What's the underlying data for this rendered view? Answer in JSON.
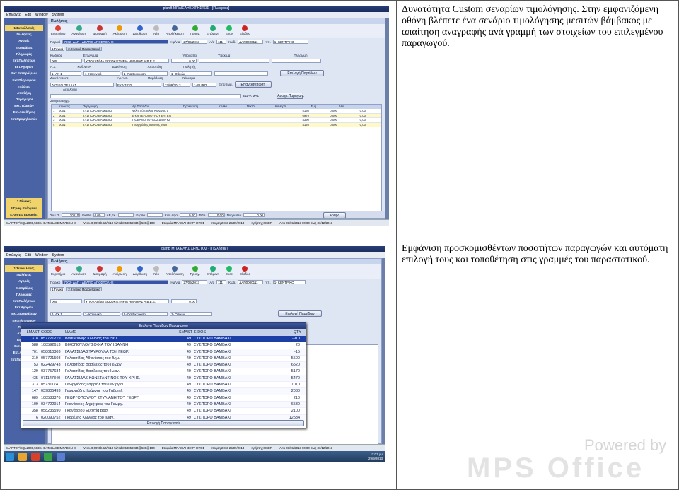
{
  "captions": {
    "row1": "Δυνατότητα Custom σεναρίων τιμολόγησης. Στην εμφανιζόμενη οθόνη βλέπετε ένα σενάριο τιμολόγησης μεσιτών βάμβακος με απαίτηση αναγραφής ανά γραμμή των στοιχείων του επιλεγμένου παραγωγού.",
    "row2": "Εμφάνιση προσκομισθέντων ποσοτήτων παραγωγών και αυτόματη επιλογή τους και τοποθέτηση στις γραμμές του παραστατικού."
  },
  "app": {
    "window_title": "planB ΜΠΑΙΕΛΗΣ ΧΡΗΣΤΟΣ - [Πωλήσεις]",
    "menu": [
      "Επιλογές",
      "Edit",
      "Window",
      "System"
    ],
    "sidebar_header": "1.Συναλλαγές",
    "sidebar_items": [
      "Πωλήσεις",
      "Αγορές",
      "Εισπράξεις",
      "Πληρωμές",
      "Εκτ.Πωλήσεων",
      "Εκτ.Αγορών",
      "Εκτ.Εισπράξεων",
      "Εκτ.Πληρωμών",
      "Πελάτες",
      "Αποθήκη",
      "Παραγωγοί",
      "Εκτ.Πελατών",
      "Εκτ.Αποθήκης",
      "Εκτ.Προμηθευτών"
    ],
    "sidebar_bottom": [
      "2.Πίνακες",
      "3.Γραφ.Ενέργειας",
      "4.Λοιπές Εργασίες"
    ],
    "content_title": "Πωλήσεις",
    "toolbar": [
      "Ευρετήριο",
      "Ανανέωση",
      "Διαγραφή",
      "Ακύρωση",
      "Διόρθωση",
      "Νέο",
      "Αποθήκευση",
      "Προηγ.",
      "Επόμενη",
      "Excel",
      "Εξοδος"
    ],
    "header": {
      "doc_type_label": "Παρ/κό",
      "doc_type_value": "7002- ΔΑΠ - ΔΕΛΤΙΟ ΑΠΟΣΤΟΛΗΣ",
      "date_label": "Ημ/νία",
      "date_value": "27/09/2013",
      "number_label": "Α/α",
      "number_value": "111",
      "code_label": "Κωδ.",
      "code_value": "ΔΑΠ0000111",
      "store_label": "Υπ.",
      "store_value": "1- ΚΕΝΤΡΙΚΟ"
    },
    "tabs": [
      "1.Γενικά",
      "2.Σχετικά Παραστατικά"
    ],
    "customer": {
      "code_label": "Κωδικός",
      "code_value": "005",
      "name_label": "Επωνυμία",
      "name_value": "ΥΠΟΚΑΤ/ΜΑ ΕΚΚΟΚΙΣΤΗΡΙΑ ΗΜΑΘΙΑΣ Α.Β.Ε.Ε.",
      "balance_label": "Υπόλοιπο",
      "balance_value": "0,00",
      "branch_label": "Υποκ/μα",
      "payment_label": "Πληρωμή",
      "am_label": "Α.Χ.",
      "am_value": "1- ΑΧ 1",
      "vat_label": "Καθ.ΦΠΑ",
      "vat_value": "1- Κανονικό",
      "route_label": "Διακίνηση",
      "route_value": "1- Για Εκκόκιση",
      "send_label": "Αποστολή",
      "send_value": "1- Οδικώς",
      "seller_label": "Πωλητής",
      "producers_button": "Επιλογή Παρτίδων",
      "addr_label": "Διευθ.Αποστ.",
      "addr_value": "ΔΥΤΙΚΟ ΠΕΛΛΑΣ",
      "car_label": "Αρ.Αυτ.",
      "car_value": "ΕΚΑ 7420",
      "deliv_label": "Παράδοση",
      "deliv_value": "27/09/2013",
      "currency_label": "Νόμισμα",
      "currency_value": "1- EURO",
      "print_label": "Εκτυπωμ.",
      "reprint_button": "Επανεκτύπωση",
      "reason_label": "Αιτιολογία",
      "edra_label": "ΕΔΡΑ ΜΑΣ",
      "price_button": "Αναγρ.Παραγωγ."
    },
    "lines_header": "Στοιχεία Εγγρ.",
    "grid_columns": [
      "Κωδικός",
      "Περιγραφή",
      "Αρ.Παρτίδος",
      "Προέλευση",
      "Κόλλα",
      "Μικτά",
      "Καθαρά",
      "Τιμή",
      "Αξία"
    ],
    "grid_rows": [
      [
        "0001",
        "ΣΥΣΠΟΡΟ ΒΑΜΒΑΚΙ",
        "Φιλιππόπουλος Κων/νος τ",
        "",
        "",
        "",
        "5130",
        "0,000",
        "0,00"
      ],
      [
        "0001",
        "ΣΥΣΠΟΡΟ ΒΑΜΒΑΚΙ",
        "ΕΥΑΓΓΕΛΟΠΟΥΛΟΥ ΕΥΓΕΝ",
        "",
        "",
        "",
        "6970",
        "0,000",
        "0,00"
      ],
      [
        "0001",
        "ΣΥΣΠΟΡΟ ΒΑΜΒΑΚΙ",
        "ΓΙΟΒΑΝΟΠΟΥΛΟΣ ΔΙΟΝΥΣ",
        "",
        "",
        "",
        "4390",
        "0,000",
        "0,00"
      ],
      [
        "0001",
        "ΣΥΣΠΟΡΟ ΒΑΜΒΑΚΙ",
        "Γεωργιάδης Ιωάννης του Γ",
        "",
        "",
        "",
        "4120",
        "0,000",
        "0,00"
      ]
    ],
    "totals": {
      "qty_label": "Συν.Π.",
      "qty_value": "20610",
      "exp_label": "Εκπ%",
      "exp_value": "0,00",
      "ae_label": "ΑΕ,Εκ.",
      "exod_label": "Εξοδα",
      "kath_label": "Καθ.Αξία",
      "kath_value": "0,00",
      "fpa_label": "ΦΠΑ",
      "fpa_value": "0,00",
      "pay_label": "Πληρωτέο",
      "pay_value": "0,00",
      "print_button": "Αρθρο"
    },
    "status": [
      "SLAPTOP\\SQL2008,50304 DATABASE:MPABELHS",
      "Vers. 0,9998b 10/9/13 5i/%dc058859034@500@100",
      "Εταιρεία:ΜΠΑΙΕΛΗΣ ΧΡΗΣΤΟΣ",
      "Χρήση:2013 29/09/2013",
      "Χρήστης:USER",
      "Απο 01/01/2013 00:00 Εως 31/12/2013"
    ]
  },
  "popup": {
    "title": "Επιλογή Παρτίδων Παραγωγού",
    "columns": [
      "LMAST",
      "CODE",
      "NAME",
      "SMAST",
      "EIDOS",
      "QTY"
    ],
    "rows": [
      [
        "318",
        "057721219",
        "Βασιλειάδης Κων/νος του Θεμ.",
        "49",
        "ΣΥΣΠΟΡΟ ΒΑΜΒΑΚΙ",
        "-910"
      ],
      [
        "588",
        "108592613",
        "ΒΙΚΟΠΟΥΛΟΥ ΣΟΦΙΑ ΤΟΥ ΙΩΑΝΝΗ",
        "49",
        "ΣΥΣΠΟΡΟ ΒΑΜΒΑΚΙ",
        "20"
      ],
      [
        "701",
        "058010303",
        "ΓΑΛΑΤΣΙΔΑ ΣΤΑΥΡΟΥΛΑ ΤΟΥ ΓΕΩΡ.",
        "49",
        "ΣΥΣΠΟΡΟ ΒΑΜΒΑΚΙ",
        "-15"
      ],
      [
        "319",
        "057721508",
        "Γαλατσίδας Αθανάσιος του Δημ.",
        "49",
        "ΣΥΣΠΟΡΟ ΒΑΜΒΑΚΙ",
        "5500"
      ],
      [
        "53",
        "022429743",
        "Γαλατσίδας Βασίλειος του Γεωργ.",
        "49",
        "ΣΥΣΠΟΡΟ ΒΑΜΒΑΚΙ",
        "6520"
      ],
      [
        "129",
        "037757684",
        "Γαλατσίδας Βασίλειος του Ιωαν.",
        "49",
        "ΣΥΣΠΟΡΟ ΒΑΜΒΑΚΙ",
        "5170"
      ],
      [
        "435",
        "071147340",
        "ΓΑΛΑΤΣΙΔΑΣ ΚΩΝΣΤΑΝΤΙΝΟΣ ΤΟΥ ΧΡΗΣ.",
        "49",
        "ΣΥΣΠΟΡΟ ΒΑΜΒΑΚΙ",
        "5470"
      ],
      [
        "313",
        "057311741",
        "Γεωργιάδης Γαβριήλ του Γεωργίου",
        "49",
        "ΣΥΣΠΟΡΟ ΒΑΜΒΑΚΙ",
        "7010"
      ],
      [
        "147",
        "039805493",
        "Γεωργιάδης Ιωάννης του Γαβριήλ",
        "49",
        "ΣΥΣΠΟΡΟ ΒΑΜΒΑΚΙ",
        "2030"
      ],
      [
        "689",
        "108583376",
        "ΓΕΩΡΓΟΠΟΥΛΟΥ ΣΤΥΛΙΑΝΗ ΤΟΥ ΓΕΩΡΓ.",
        "49",
        "ΣΥΣΠΟΡΟ ΒΑΜΒΑΚΙ",
        "210"
      ],
      [
        "109",
        "034722914",
        "Γκανάτσιος Δημήτριος του Γεωργ.",
        "49",
        "ΣΥΣΠΟΡΟ ΒΑΜΒΑΚΙ",
        "6530"
      ],
      [
        "358",
        "058235590",
        "Γκανάτσιου Ευτυχία Βασ.",
        "49",
        "ΣΥΣΠΟΡΟ ΒΑΜΒΑΚΙ",
        "2100"
      ],
      [
        "6",
        "020090752",
        "Γκαρέλης Κων/νος του Ιωαν.",
        "49",
        "ΣΥΣΠΟΡΟ ΒΑΜΒΑΚΙ",
        "12534"
      ]
    ],
    "select_button": "Επιλογή Παραγωγού"
  },
  "taskbar": {
    "time": "11:01 μμ",
    "date": "29/9/2013"
  },
  "watermark": {
    "line1": "Powered by",
    "line2": "MPS Office"
  },
  "colors": {
    "sidebar": "#4a63a4",
    "selected_row": "#1c3fa6",
    "alt_row": "#fff9c8"
  }
}
